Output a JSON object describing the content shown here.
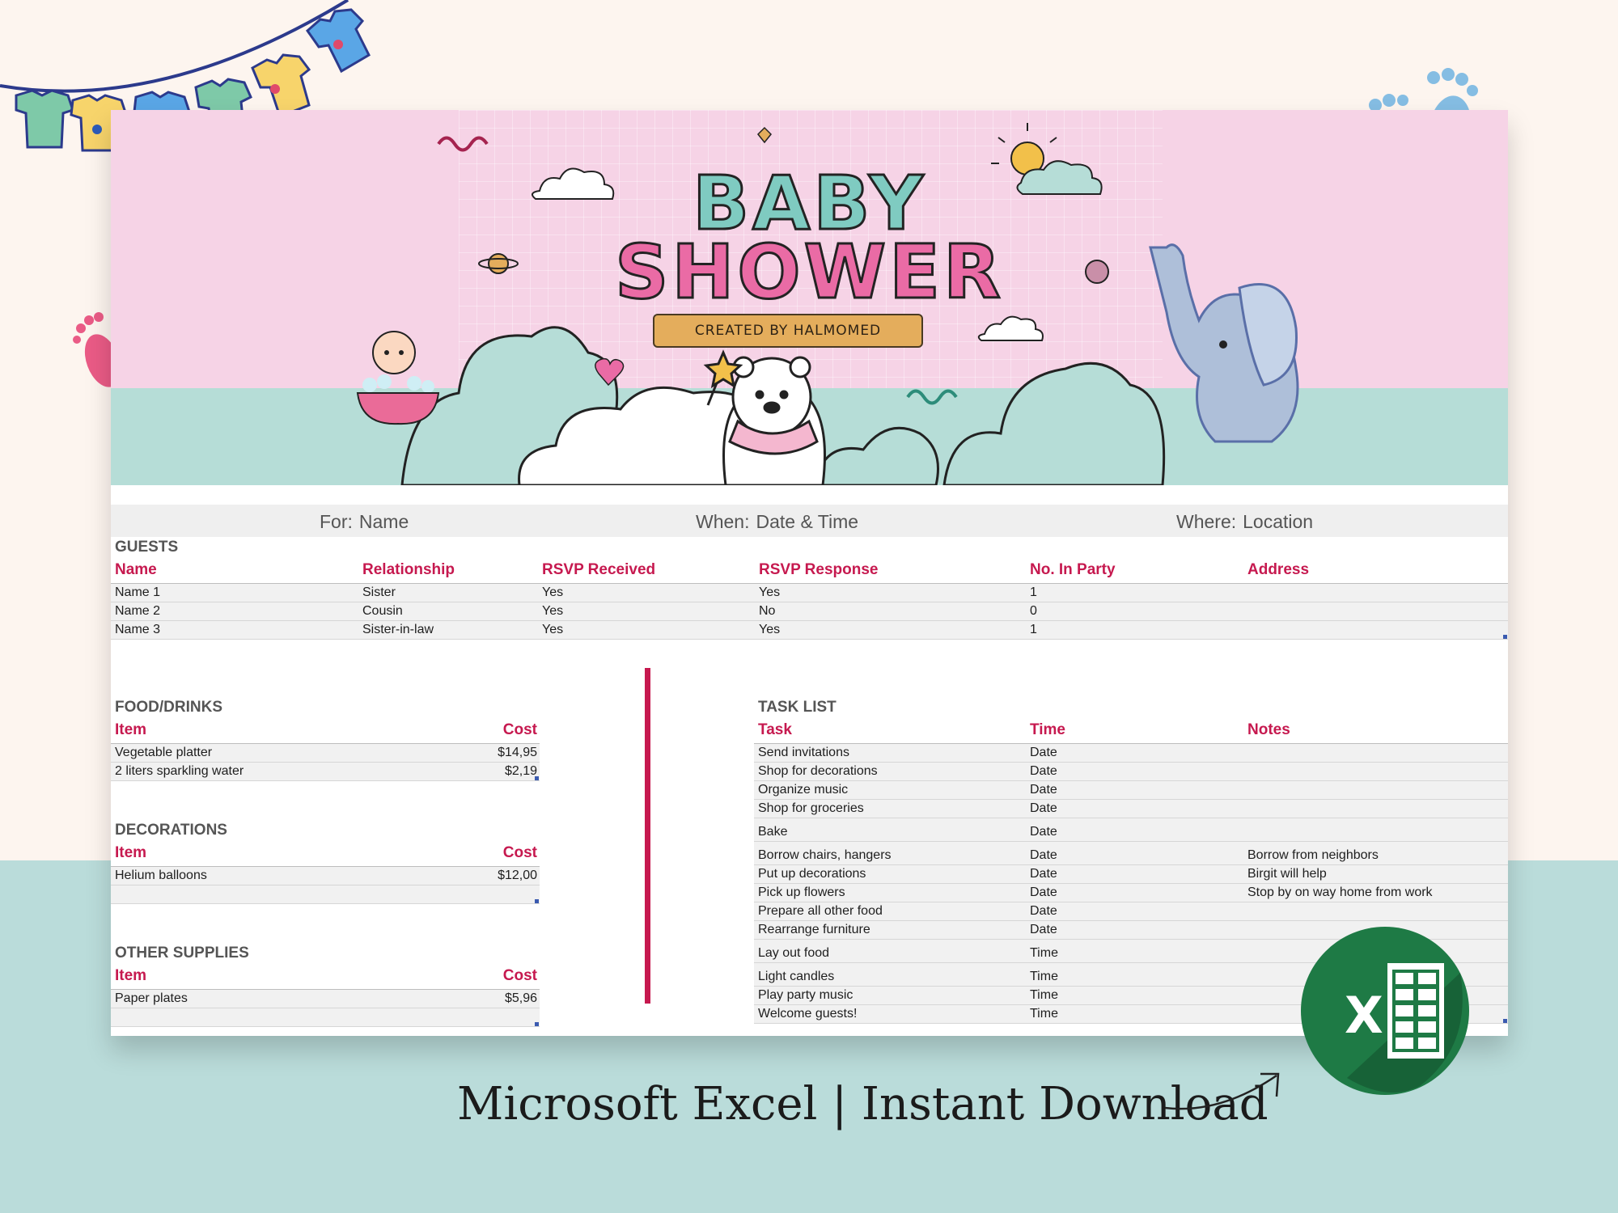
{
  "banner": {
    "title_line1": "BABY",
    "title_line2": "SHOWER",
    "creator": "CREATED BY HALMOMED"
  },
  "info": [
    {
      "label": "For:",
      "value": "Name"
    },
    {
      "label": "When:",
      "value": "Date & Time"
    },
    {
      "label": "Where:",
      "value": "Location"
    }
  ],
  "guests": {
    "title": "GUESTS",
    "headers": [
      "Name",
      "Relationship",
      "RSVP Received",
      "RSVP Response",
      "No. In Party",
      "Address"
    ],
    "rows": [
      [
        "Name 1",
        "Sister",
        "Yes",
        "Yes",
        "1",
        ""
      ],
      [
        "Name 2",
        "Cousin",
        "Yes",
        "No",
        "0",
        ""
      ],
      [
        "Name 3",
        "Sister-in-law",
        "Yes",
        "Yes",
        "1",
        ""
      ]
    ]
  },
  "food": {
    "title": "FOOD/DRINKS",
    "headers": [
      "Item",
      "Cost"
    ],
    "rows": [
      [
        "Vegetable platter",
        "$14,95"
      ],
      [
        "2 liters sparkling water",
        "$2,19"
      ]
    ]
  },
  "decorations": {
    "title": "DECORATIONS",
    "headers": [
      "Item",
      "Cost"
    ],
    "rows": [
      [
        "Helium balloons",
        "$12,00"
      ],
      [
        "",
        ""
      ]
    ]
  },
  "supplies": {
    "title": "OTHER SUPPLIES",
    "headers": [
      "Item",
      "Cost"
    ],
    "rows": [
      [
        "Paper plates",
        "$5,96"
      ],
      [
        "",
        ""
      ]
    ]
  },
  "tasks": {
    "title": "TASK LIST",
    "headers": [
      "Task",
      "Time",
      "Notes"
    ],
    "rows": [
      [
        "Send invitations",
        "Date",
        ""
      ],
      [
        "Shop for decorations",
        "Date",
        ""
      ],
      [
        "Organize music",
        "Date",
        ""
      ],
      [
        "Shop for groceries",
        "Date",
        ""
      ],
      [
        "Bake",
        "Date",
        ""
      ],
      [
        "Borrow chairs, hangers",
        "Date",
        "Borrow from neighbors"
      ],
      [
        "Put up decorations",
        "Date",
        "Birgit will help"
      ],
      [
        "Pick up flowers",
        "Date",
        "Stop by on way home from work"
      ],
      [
        "Prepare all other food",
        "Date",
        ""
      ],
      [
        "Rearrange furniture",
        "Date",
        ""
      ],
      [
        "Lay out food",
        "Time",
        ""
      ],
      [
        "Light candles",
        "Time",
        ""
      ],
      [
        "Play party music",
        "Time",
        ""
      ],
      [
        "Welcome guests!",
        "Time",
        ""
      ]
    ]
  },
  "caption": "Microsoft Excel | Instant Download",
  "logo_letter": "X",
  "colors": {
    "accent": "#c6194f",
    "banner_pink": "#f6d3e6",
    "ground_teal": "#b6ddd7",
    "excel_green": "#1e7a45"
  },
  "icons": [
    "onesie-bunting-icon",
    "baby-feet-icon",
    "excel-logo-icon",
    "arrow-icon",
    "bear-icon",
    "elephant-icon",
    "baby-bath-icon",
    "cloud-icon",
    "sun-icon"
  ]
}
